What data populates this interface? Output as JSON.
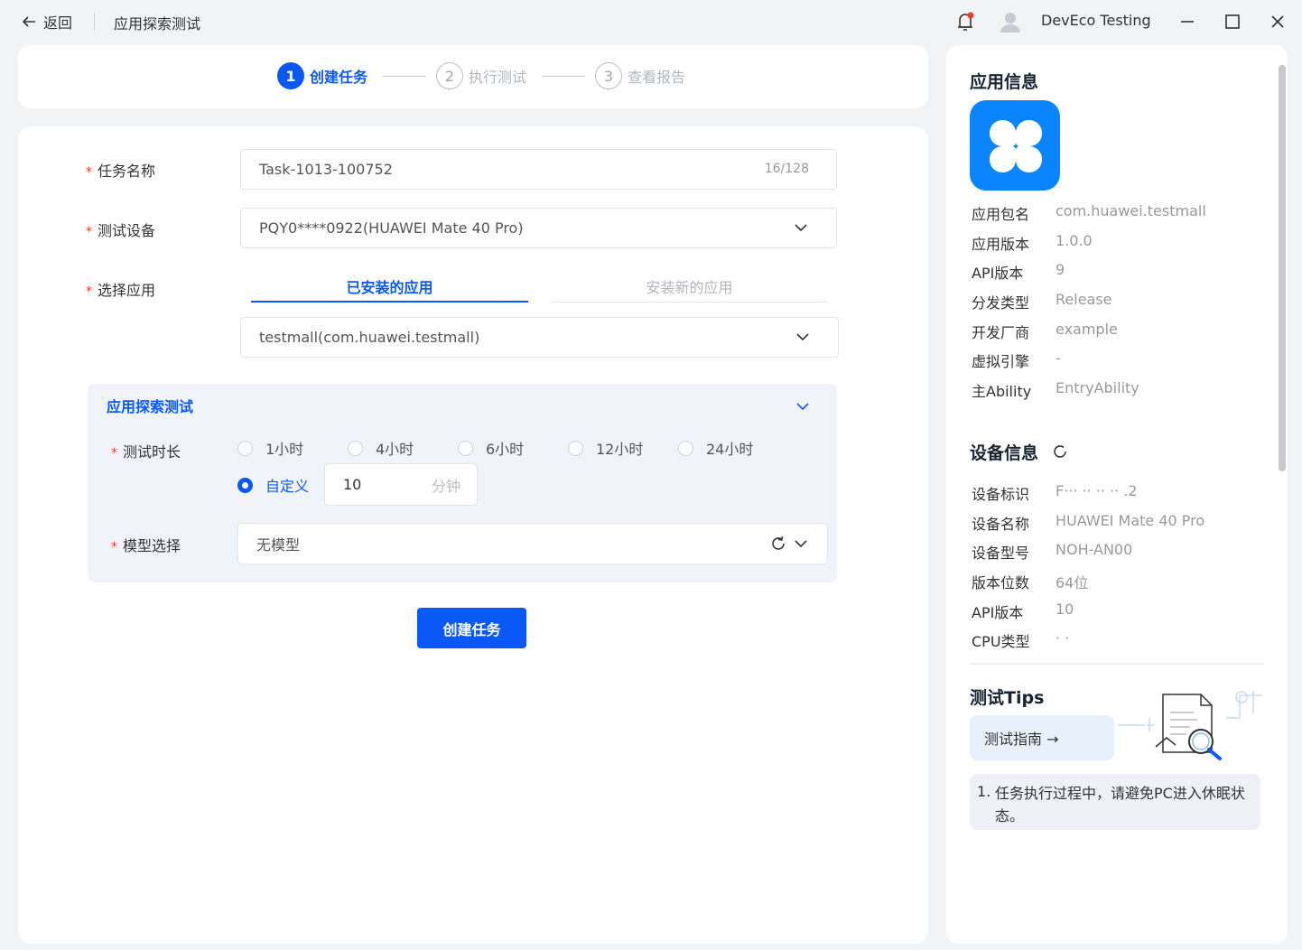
{
  "titlebar": {
    "back_label": "返回",
    "title": "应用探索测试",
    "username": "DevEco Testing"
  },
  "stepper": [
    {
      "num": "1",
      "label": "创建任务"
    },
    {
      "num": "2",
      "label": "执行测试"
    },
    {
      "num": "3",
      "label": "查看报告"
    }
  ],
  "form": {
    "task_name": {
      "label": "任务名称",
      "value": "Task-1013-100752",
      "counter": "16/128"
    },
    "device": {
      "label": "测试设备",
      "value": "PQY0****0922(HUAWEI Mate 40 Pro)"
    },
    "app": {
      "label": "选择应用",
      "tab_installed": "已安装的应用",
      "tab_new": "安装新的应用",
      "value": "testmall(com.huawei.testmall)"
    },
    "explore": {
      "title": "应用探索测试",
      "duration_label": "测试时长",
      "options": [
        "1小时",
        "4小时",
        "6小时",
        "12小时",
        "24小时"
      ],
      "custom_label": "自定义",
      "custom_value": "10",
      "custom_unit": "分钟",
      "model_label": "模型选择",
      "model_value": "无模型"
    },
    "create_button": "创建任务"
  },
  "app_info": {
    "title": "应用信息",
    "fields": [
      {
        "k": "应用包名",
        "v": "com.huawei.testmall"
      },
      {
        "k": "应用版本",
        "v": "1.0.0"
      },
      {
        "k": "API版本",
        "v": "9"
      },
      {
        "k": "分发类型",
        "v": "Release"
      },
      {
        "k": "开发厂商",
        "v": "example"
      },
      {
        "k": "虚拟引擎",
        "v": "-"
      },
      {
        "k": "主Ability",
        "v": "EntryAbility"
      }
    ]
  },
  "device_info": {
    "title": "设备信息",
    "fields": [
      {
        "k": "设备标识",
        "v": "F··· ·· ·· ·· .2"
      },
      {
        "k": "设备名称",
        "v": "HUAWEI Mate 40 Pro"
      },
      {
        "k": "设备型号",
        "v": "NOH-AN00"
      },
      {
        "k": "版本位数",
        "v": "64位"
      },
      {
        "k": "API版本",
        "v": "10"
      },
      {
        "k": "CPU类型",
        "v": "· ·"
      }
    ]
  },
  "tips": {
    "title": "测试Tips",
    "guide_button": "测试指南 →",
    "items": [
      {
        "num": "1.",
        "text": "任务执行过程中，请避免PC进入休眠状态。"
      }
    ]
  },
  "colors": {
    "accent": "#0a59f7",
    "app_icon": "#0a84ff",
    "required": "#e84026"
  }
}
